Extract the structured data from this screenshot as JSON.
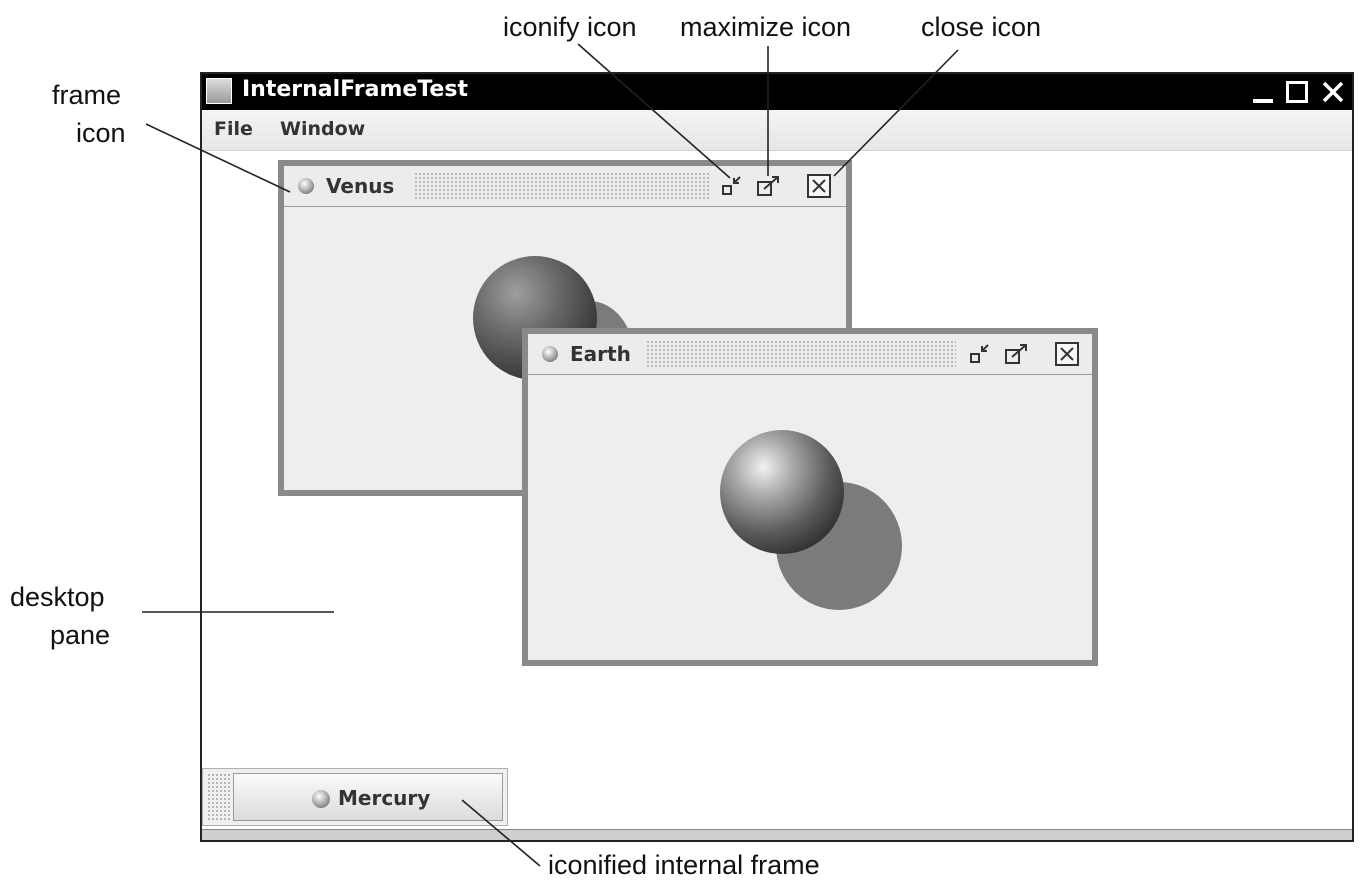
{
  "annotations": {
    "iconify_icon": "iconify icon",
    "maximize_icon": "maximize icon",
    "close_icon": "close icon",
    "frame_icon_line1": "frame",
    "frame_icon_line2": "icon",
    "desktop_pane_line1": "desktop",
    "desktop_pane_line2": "pane",
    "iconified_internal_frame": "iconified internal frame"
  },
  "window": {
    "title": "InternalFrameTest",
    "controls": [
      "minimize-icon",
      "maximize-icon",
      "close-icon"
    ]
  },
  "menubar": {
    "items": [
      "File",
      "Window"
    ]
  },
  "internal_frames": [
    {
      "title": "Venus",
      "icon": "frame-icon",
      "buttons": [
        "iconify-icon",
        "maximize-icon",
        "close-icon"
      ],
      "image": "venus planet"
    },
    {
      "title": "Earth",
      "icon": "frame-icon",
      "buttons": [
        "iconify-icon",
        "maximize-icon",
        "close-icon"
      ],
      "image": "earth planet"
    }
  ],
  "iconified_frame": {
    "title": "Mercury",
    "icon": "frame-icon"
  }
}
